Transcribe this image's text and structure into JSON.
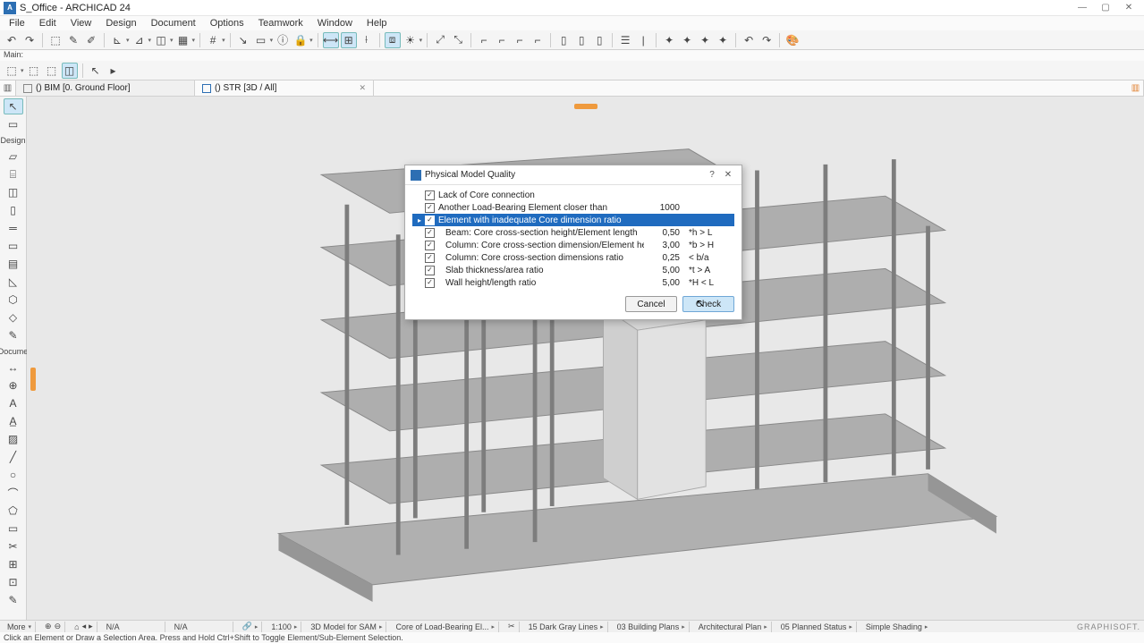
{
  "titlebar": {
    "title": "S_Office - ARCHICAD 24"
  },
  "menu": {
    "items": [
      "File",
      "Edit",
      "View",
      "Design",
      "Document",
      "Options",
      "Teamwork",
      "Window",
      "Help"
    ]
  },
  "sub_label": "Main:",
  "tabs": {
    "t1": "() BIM [0. Ground Floor]",
    "t2": "() STR [3D / All]"
  },
  "left_panel": {
    "label_design": "Design",
    "label_docs": "Docume"
  },
  "dialog": {
    "title": "Physical Model Quality",
    "rows": [
      {
        "label": "Lack of Core connection",
        "val": "",
        "unit": "",
        "indent": false,
        "selected": false
      },
      {
        "label": "Another Load-Bearing Element closer than",
        "val": "1000",
        "unit": "",
        "indent": false,
        "selected": false
      },
      {
        "label": "Element with inadequate Core dimension ratio",
        "val": "",
        "unit": "",
        "indent": false,
        "selected": true
      },
      {
        "label": "Beam: Core cross-section height/Element length",
        "val": "0,50",
        "unit": "*h > L",
        "indent": true,
        "selected": false
      },
      {
        "label": "Column: Core cross-section dimension/Element height",
        "val": "3,00",
        "unit": "*b > H",
        "indent": true,
        "selected": false
      },
      {
        "label": "Column: Core cross-section dimensions ratio",
        "val": "0,25",
        "unit": "< b/a",
        "indent": true,
        "selected": false
      },
      {
        "label": "Slab thickness/area ratio",
        "val": "5,00",
        "unit": "*t > A",
        "indent": true,
        "selected": false
      },
      {
        "label": "Wall height/length ratio",
        "val": "5,00",
        "unit": "*H < L",
        "indent": true,
        "selected": false
      }
    ],
    "cancel": "Cancel",
    "check": "Check"
  },
  "bottom": {
    "more": "More",
    "na1": "N/A",
    "na2": "N/A",
    "scale": "1:100",
    "model": "3D Model for SAM",
    "core": "Core of Load-Bearing El...",
    "lines": "15 Dark Gray Lines",
    "plans": "03 Building Plans",
    "arch": "Architectural Plan",
    "planned": "05 Planned Status",
    "shading": "Simple Shading",
    "logo": "GRAPHISOFT."
  },
  "status": "Click an Element or Draw a Selection Area. Press and Hold Ctrl+Shift to Toggle Element/Sub-Element Selection."
}
